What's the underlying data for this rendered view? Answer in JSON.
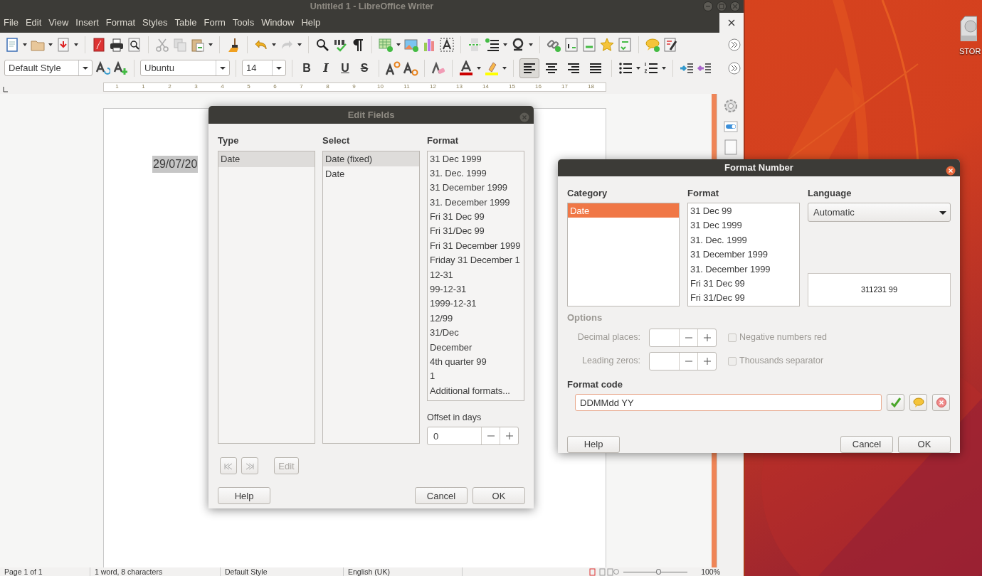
{
  "window": {
    "title": "Untitled 1 - LibreOffice Writer"
  },
  "menu": [
    "File",
    "Edit",
    "View",
    "Insert",
    "Format",
    "Styles",
    "Table",
    "Form",
    "Tools",
    "Window",
    "Help"
  ],
  "formatting": {
    "paragraph_style": "Default Style",
    "font_name": "Ubuntu",
    "font_size": "14",
    "text_buttons": [
      "B",
      "I",
      "U",
      "S"
    ],
    "alignment": [
      {
        "selected": true
      },
      {
        "selected": false
      },
      {
        "selected": false
      },
      {
        "selected": false
      }
    ]
  },
  "ruler": [
    "1",
    "1",
    "2",
    "3",
    "4",
    "5",
    "6",
    "7",
    "8",
    "9",
    "10",
    "11",
    "12",
    "13",
    "14",
    "15",
    "16",
    "17",
    "18"
  ],
  "document": {
    "text": "29/07/20",
    "selected": true
  },
  "status_bar": {
    "page": "Page 1 of 1",
    "words": "1 word, 8 characters",
    "style": "Default Style",
    "language": "English (UK)",
    "zoom_slider": {
      "level": 0.55
    },
    "zoom": "100%"
  },
  "desktop": {
    "icons": [
      {
        "label": "STOR"
      }
    ]
  },
  "edit_fields": {
    "title": "Edit Fields",
    "type": {
      "label": "Type",
      "items": [
        {
          "text": "Date",
          "selected": true
        }
      ]
    },
    "select": {
      "label": "Select",
      "items": [
        {
          "text": "Date (fixed)",
          "selected": true
        },
        {
          "text": "Date",
          "selected": false
        }
      ]
    },
    "format": {
      "label": "Format",
      "items": [
        {
          "text": "31 Dec 1999",
          "selected": false
        },
        {
          "text": "31. Dec. 1999",
          "selected": false
        },
        {
          "text": "31 December 1999",
          "selected": false
        },
        {
          "text": "31. December 1999",
          "selected": false
        },
        {
          "text": "Fri 31 Dec 99",
          "selected": false
        },
        {
          "text": "Fri 31/Dec 99",
          "selected": false
        },
        {
          "text": "Fri 31 December 1999",
          "selected": false
        },
        {
          "text": "Friday 31 December 1",
          "selected": false
        },
        {
          "text": "12-31",
          "selected": false
        },
        {
          "text": "99-12-31",
          "selected": false
        },
        {
          "text": "1999-12-31",
          "selected": false
        },
        {
          "text": "12/99",
          "selected": false
        },
        {
          "text": "31/Dec",
          "selected": false
        },
        {
          "text": "December",
          "selected": false
        },
        {
          "text": "4th quarter 99",
          "selected": false
        },
        {
          "text": "1",
          "selected": false
        },
        {
          "text": "Additional formats...",
          "selected": false
        }
      ]
    },
    "offset": {
      "label": "Offset in days",
      "value": "0"
    },
    "edit_button": {
      "label": "Edit",
      "disabled": true
    },
    "buttons": [
      "Help",
      "Cancel",
      "OK"
    ]
  },
  "format_number": {
    "title": "Format Number",
    "category": {
      "label": "Category",
      "items": [
        {
          "text": "Date",
          "selected": true
        }
      ]
    },
    "format": {
      "label": "Format",
      "items": [
        {
          "text": "31 Dec 99",
          "selected": false
        },
        {
          "text": "31 Dec 1999",
          "selected": false
        },
        {
          "text": "31. Dec. 1999",
          "selected": false
        },
        {
          "text": "31 December 1999",
          "selected": false
        },
        {
          "text": "31. December 1999",
          "selected": false
        },
        {
          "text": "Fri 31 Dec 99",
          "selected": false
        },
        {
          "text": "Fri 31/Dec 99",
          "selected": false
        }
      ]
    },
    "language": {
      "label": "Language",
      "value": "Automatic"
    },
    "preview": "311231 99",
    "options": {
      "label": "Options",
      "disabled": true,
      "spinners": [
        {
          "label": "Decimal places:"
        },
        {
          "label": "Leading zeros:"
        }
      ],
      "checkboxes": [
        {
          "label": "Negative numbers red",
          "checked": false
        },
        {
          "label": "Thousands separator",
          "checked": false
        }
      ]
    },
    "format_code": {
      "label": "Format code",
      "value": "DDMMdd YY"
    },
    "buttons": [
      "Help",
      "Cancel",
      "OK"
    ]
  }
}
